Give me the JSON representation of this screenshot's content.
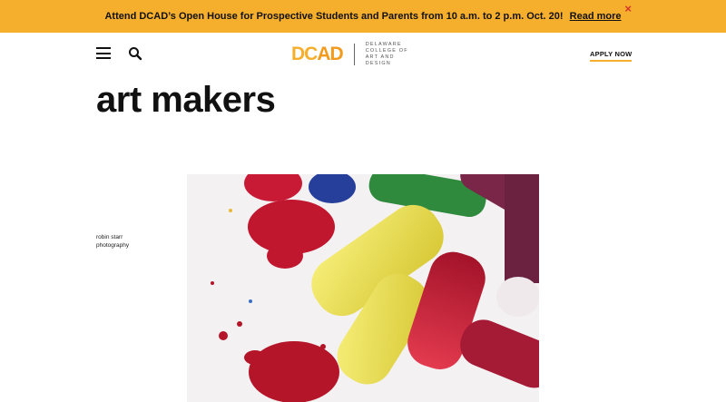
{
  "banner": {
    "message": "Attend DCAD’s Open House for Prospective Students and Parents from 10 a.m. to 2 p.m. Oct. 20!",
    "link": "Read more",
    "close": "×"
  },
  "header": {
    "logo_main_1": "DC",
    "logo_main_2": "AD",
    "logo_sub": "Delaware College of Art and Design",
    "apply": "APPLY NOW"
  },
  "page": {
    "title": "art makers",
    "caption": "robin starr photography"
  },
  "icons": {
    "menu": "hamburger-menu-icon",
    "search": "search-icon",
    "close": "close-icon"
  },
  "colors": {
    "banner": "#f6ae2d",
    "accent": "#f6ae2d",
    "close": "#d4342c"
  }
}
